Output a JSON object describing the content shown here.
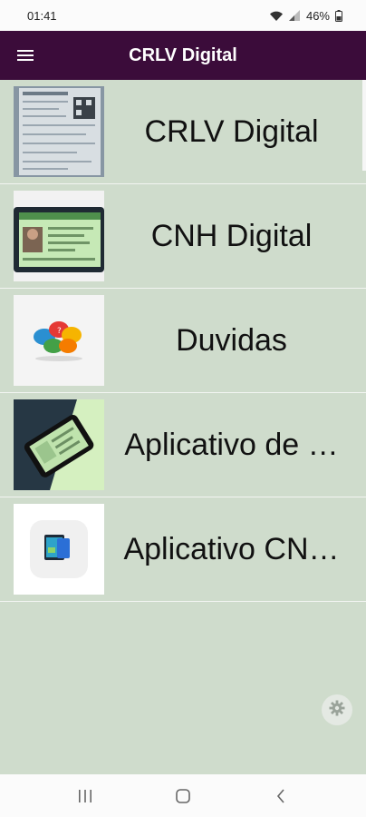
{
  "status_bar": {
    "time": "01:41",
    "battery": "46%",
    "icons": [
      "wifi-icon",
      "signal-icon",
      "battery-icon"
    ]
  },
  "app_bar": {
    "title": "CRLV Digital",
    "menu_icon": "hamburger-menu-icon"
  },
  "items": [
    {
      "label": "CRLV Digital",
      "thumbnail": "crlv-document-thumbnail"
    },
    {
      "label": "CNH Digital",
      "thumbnail": "cnh-license-thumbnail"
    },
    {
      "label": "Duvidas",
      "thumbnail": "speech-bubbles-thumbnail"
    },
    {
      "label": "Aplicativo de …",
      "thumbnail": "phone-app-thumbnail"
    },
    {
      "label": "Aplicativo CN…",
      "thumbnail": "app-icon-thumbnail"
    }
  ],
  "settings_button": {
    "icon": "gear-icon"
  },
  "nav_bar": {
    "icons": [
      "recents-icon",
      "home-icon",
      "back-icon"
    ]
  },
  "colors": {
    "app_bar": "#3b0c3a",
    "background": "#cfdccc",
    "divider": "#f3f5f2"
  }
}
